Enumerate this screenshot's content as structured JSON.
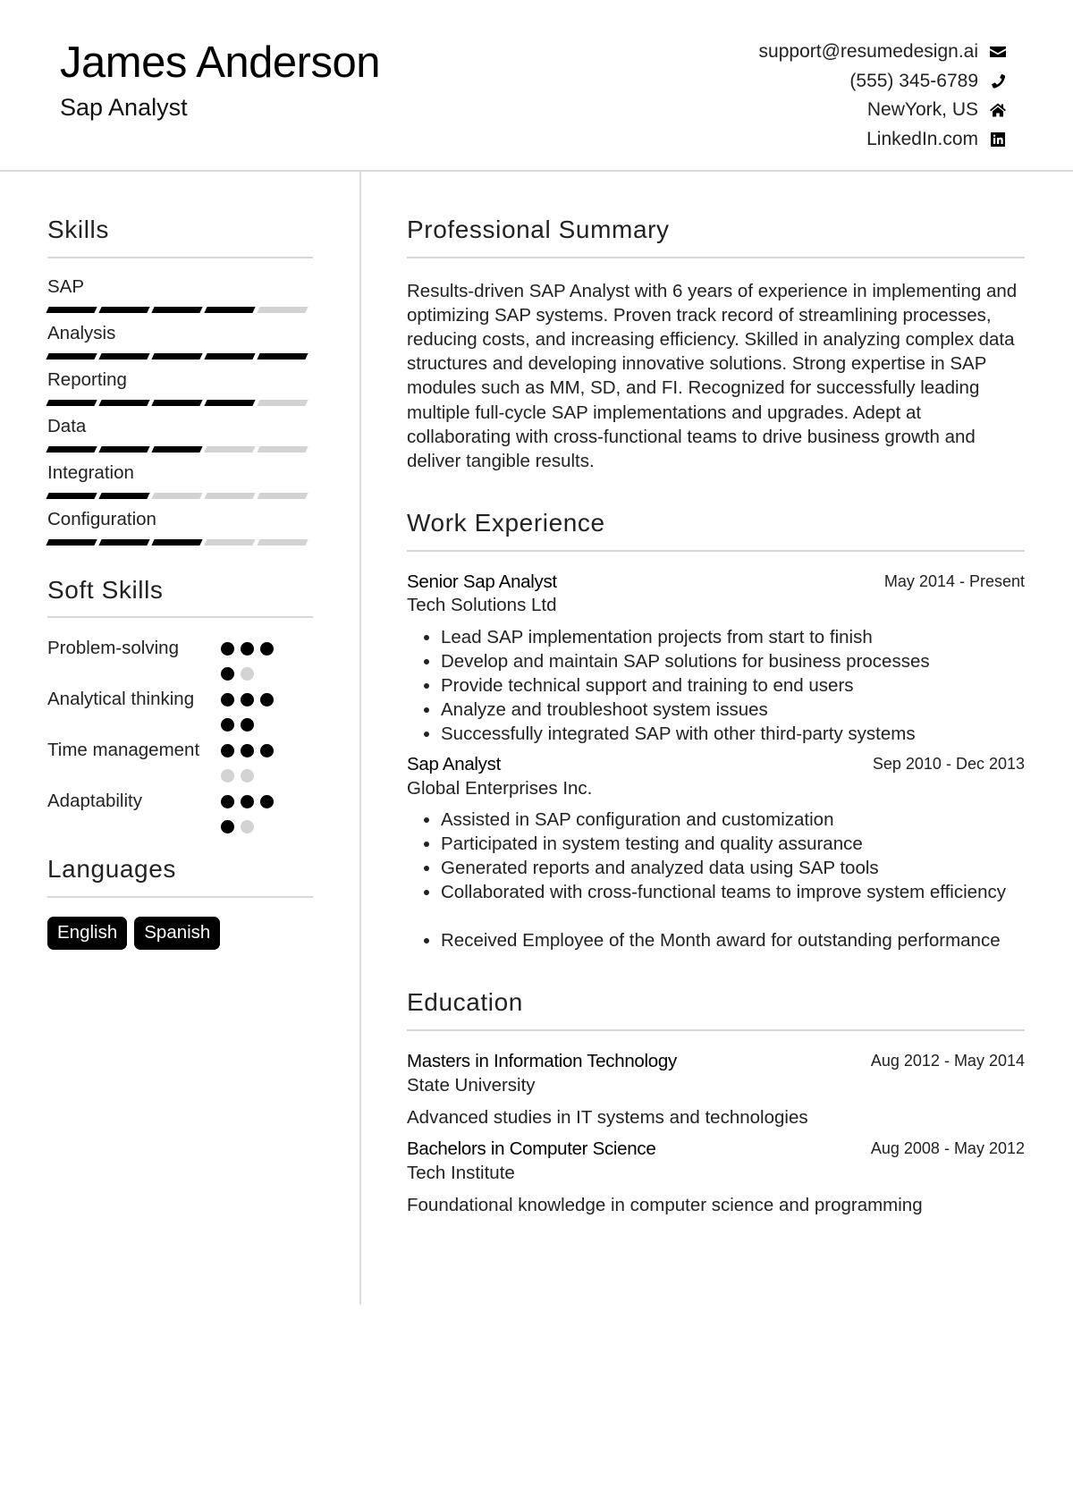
{
  "header": {
    "name": "James Anderson",
    "title": "Sap Analyst",
    "contacts": [
      {
        "text": "support@resumedesign.ai",
        "icon": "envelope-icon"
      },
      {
        "text": "(555) 345-6789",
        "icon": "phone-icon"
      },
      {
        "text": "NewYork, US",
        "icon": "home-icon"
      },
      {
        "text": "LinkedIn.com",
        "icon": "linkedin-icon"
      }
    ]
  },
  "sidebar": {
    "skills": {
      "title": "Skills",
      "max": 5,
      "items": [
        {
          "name": "SAP",
          "level": 4
        },
        {
          "name": "Analysis",
          "level": 5
        },
        {
          "name": "Reporting",
          "level": 4
        },
        {
          "name": "Data",
          "level": 3
        },
        {
          "name": "Integration",
          "level": 2
        },
        {
          "name": "Configuration",
          "level": 3
        }
      ]
    },
    "soft_skills": {
      "title": "Soft Skills",
      "max": 5,
      "items": [
        {
          "name": "Problem-solving",
          "level": 4
        },
        {
          "name": "Analytical thinking",
          "level": 5
        },
        {
          "name": "Time management",
          "level": 3
        },
        {
          "name": "Adaptability",
          "level": 4
        }
      ]
    },
    "languages": {
      "title": "Languages",
      "items": [
        "English",
        "Spanish"
      ]
    }
  },
  "main": {
    "summary": {
      "title": "Professional Summary",
      "text": "Results-driven SAP Analyst with 6 years of experience in implementing and optimizing SAP systems. Proven track record of streamlining processes, reducing costs, and increasing efficiency. Skilled in analyzing complex data structures and developing innovative solutions. Strong expertise in SAP modules such as MM, SD, and FI. Recognized for successfully leading multiple full-cycle SAP implementations and upgrades. Adept at collaborating with cross-functional teams to drive business growth and deliver tangible results."
    },
    "experience": {
      "title": "Work Experience",
      "jobs": [
        {
          "role": "Senior Sap Analyst",
          "company": "Tech Solutions Ltd",
          "dates": "May 2014 - Present",
          "bullets": [
            "Lead SAP implementation projects from start to finish",
            "Develop and maintain SAP solutions for business processes",
            "Provide technical support and training to end users",
            "Analyze and troubleshoot system issues",
            "Successfully integrated SAP with other third-party systems"
          ]
        },
        {
          "role": "Sap Analyst",
          "company": "Global Enterprises Inc.",
          "dates": "Sep 2010 - Dec 2013",
          "bullets": [
            "Assisted in SAP configuration and customization",
            "Participated in system testing and quality assurance",
            "Generated reports and analyzed data using SAP tools",
            "Collaborated with cross-functional teams to improve system efficiency",
            "Received Employee of the Month award for outstanding performance"
          ]
        }
      ]
    },
    "education": {
      "title": "Education",
      "items": [
        {
          "degree": "Masters in Information Technology",
          "school": "State University",
          "dates": "Aug 2012 - May 2014",
          "description": "Advanced studies in IT systems and technologies"
        },
        {
          "degree": "Bachelors in Computer Science",
          "school": "Tech Institute",
          "dates": "Aug 2008 - May 2012",
          "description": "Foundational knowledge in computer science and programming"
        }
      ]
    }
  }
}
